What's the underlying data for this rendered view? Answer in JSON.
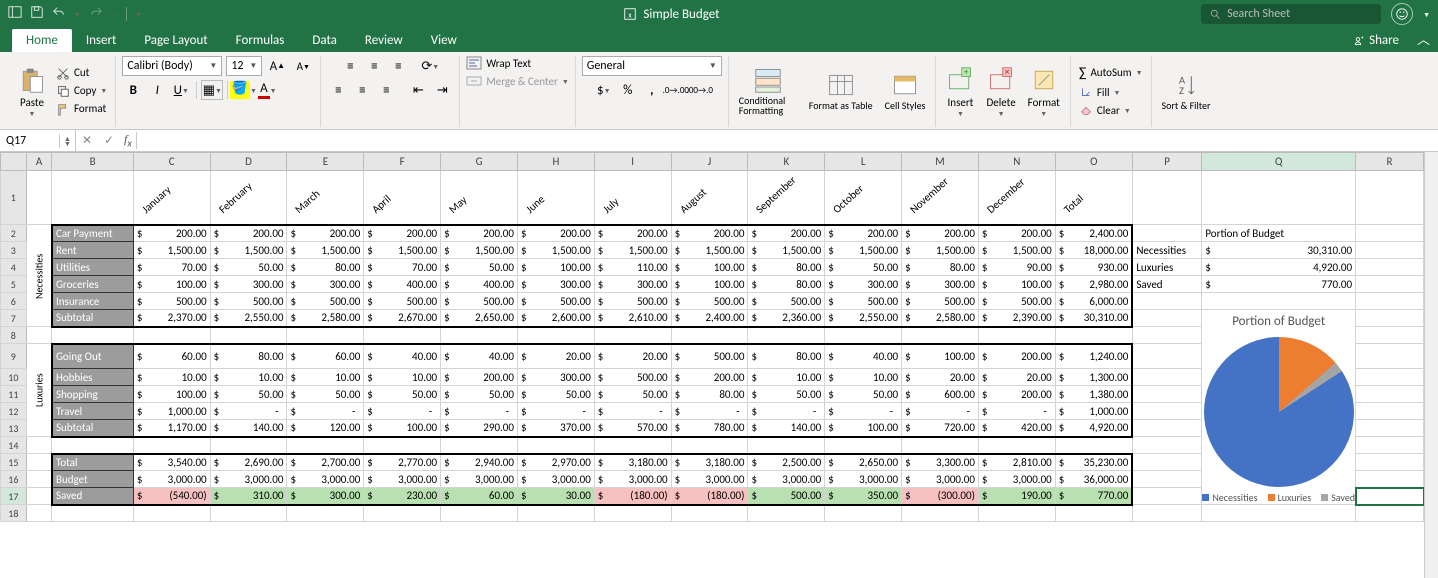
{
  "app": {
    "title": "Simple Budget",
    "search_placeholder": "Search Sheet"
  },
  "tabs": {
    "home": "Home",
    "insert": "Insert",
    "page_layout": "Page Layout",
    "formulas": "Formulas",
    "data": "Data",
    "review": "Review",
    "view": "View",
    "share": "Share"
  },
  "ribbon": {
    "paste": "Paste",
    "cut": "Cut",
    "copy": "Copy",
    "format_painter": "Format",
    "font_name": "Calibri (Body)",
    "font_size": "12",
    "wrap_text": "Wrap Text",
    "merge_center": "Merge & Center",
    "num_format": "General",
    "cond_fmt": "Conditional Formatting",
    "fmt_table": "Format as Table",
    "cell_styles": "Cell Styles",
    "insert_btn": "Insert",
    "delete_btn": "Delete",
    "format_btn": "Format",
    "autosum": "AutoSum",
    "fill": "Fill",
    "clear": "Clear",
    "sort_filter": "Sort & Filter"
  },
  "cell_ref": "Q17",
  "months": [
    "January",
    "February",
    "March",
    "April",
    "May",
    "June",
    "July",
    "August",
    "September",
    "October",
    "November",
    "December",
    "Total"
  ],
  "rows": {
    "necessities_label": "Necessities",
    "luxuries_label": "Luxuries",
    "car": "Car Payment",
    "rent": "Rent",
    "util": "Utilities",
    "groc": "Groceries",
    "ins": "Insurance",
    "sub": "Subtotal",
    "go": "Going Out",
    "hob": "Hobbies",
    "shop": "Shopping",
    "trav": "Travel",
    "total": "Total",
    "budget": "Budget",
    "saved": "Saved"
  },
  "data": {
    "car": [
      "200.00",
      "200.00",
      "200.00",
      "200.00",
      "200.00",
      "200.00",
      "200.00",
      "200.00",
      "200.00",
      "200.00",
      "200.00",
      "200.00",
      "2,400.00"
    ],
    "rent": [
      "1,500.00",
      "1,500.00",
      "1,500.00",
      "1,500.00",
      "1,500.00",
      "1,500.00",
      "1,500.00",
      "1,500.00",
      "1,500.00",
      "1,500.00",
      "1,500.00",
      "1,500.00",
      "18,000.00"
    ],
    "util": [
      "70.00",
      "50.00",
      "80.00",
      "70.00",
      "50.00",
      "100.00",
      "110.00",
      "100.00",
      "80.00",
      "50.00",
      "80.00",
      "90.00",
      "930.00"
    ],
    "groc": [
      "100.00",
      "300.00",
      "300.00",
      "400.00",
      "400.00",
      "300.00",
      "300.00",
      "100.00",
      "80.00",
      "300.00",
      "300.00",
      "100.00",
      "2,980.00"
    ],
    "ins": [
      "500.00",
      "500.00",
      "500.00",
      "500.00",
      "500.00",
      "500.00",
      "500.00",
      "500.00",
      "500.00",
      "500.00",
      "500.00",
      "500.00",
      "6,000.00"
    ],
    "nsub": [
      "2,370.00",
      "2,550.00",
      "2,580.00",
      "2,670.00",
      "2,650.00",
      "2,600.00",
      "2,610.00",
      "2,400.00",
      "2,360.00",
      "2,550.00",
      "2,580.00",
      "2,390.00",
      "30,310.00"
    ],
    "go": [
      "60.00",
      "80.00",
      "60.00",
      "40.00",
      "40.00",
      "20.00",
      "20.00",
      "500.00",
      "80.00",
      "40.00",
      "100.00",
      "200.00",
      "1,240.00"
    ],
    "hob": [
      "10.00",
      "10.00",
      "10.00",
      "10.00",
      "200.00",
      "300.00",
      "500.00",
      "200.00",
      "10.00",
      "10.00",
      "20.00",
      "20.00",
      "1,300.00"
    ],
    "shop": [
      "100.00",
      "50.00",
      "50.00",
      "50.00",
      "50.00",
      "50.00",
      "50.00",
      "80.00",
      "50.00",
      "50.00",
      "600.00",
      "200.00",
      "1,380.00"
    ],
    "trav": [
      "1,000.00",
      "-",
      "-",
      "-",
      "-",
      "-",
      "-",
      "-",
      "-",
      "-",
      "-",
      "-",
      "1,000.00"
    ],
    "lsub": [
      "1,170.00",
      "140.00",
      "120.00",
      "100.00",
      "290.00",
      "370.00",
      "570.00",
      "780.00",
      "140.00",
      "100.00",
      "720.00",
      "420.00",
      "4,920.00"
    ],
    "total": [
      "3,540.00",
      "2,690.00",
      "2,700.00",
      "2,770.00",
      "2,940.00",
      "2,970.00",
      "3,180.00",
      "3,180.00",
      "2,500.00",
      "2,650.00",
      "3,300.00",
      "2,810.00",
      "35,230.00"
    ],
    "budget": [
      "3,000.00",
      "3,000.00",
      "3,000.00",
      "3,000.00",
      "3,000.00",
      "3,000.00",
      "3,000.00",
      "3,000.00",
      "3,000.00",
      "3,000.00",
      "3,000.00",
      "3,000.00",
      "36,000.00"
    ],
    "saved": [
      "(540.00)",
      "310.00",
      "300.00",
      "230.00",
      "60.00",
      "30.00",
      "(180.00)",
      "(180.00)",
      "500.00",
      "350.00",
      "(300.00)",
      "190.00",
      "770.00"
    ]
  },
  "saved_neg": [
    true,
    false,
    false,
    false,
    false,
    false,
    true,
    true,
    false,
    false,
    true,
    false,
    false
  ],
  "summary": {
    "title": "Portion of Budget",
    "rows": [
      {
        "label": "Necessities",
        "val": "30,310.00"
      },
      {
        "label": "Luxuries",
        "val": "4,920.00"
      },
      {
        "label": "Saved",
        "val": "770.00"
      }
    ]
  },
  "chart_data": {
    "type": "pie",
    "title": "Portion of Budget",
    "series": [
      {
        "name": "Portion",
        "values": [
          30310,
          4920,
          770
        ]
      }
    ],
    "categories": [
      "Necessities",
      "Luxuries",
      "Saved"
    ],
    "colors": [
      "#4472c4",
      "#ed7d31",
      "#a5a5a5"
    ],
    "legend_position": "bottom"
  }
}
